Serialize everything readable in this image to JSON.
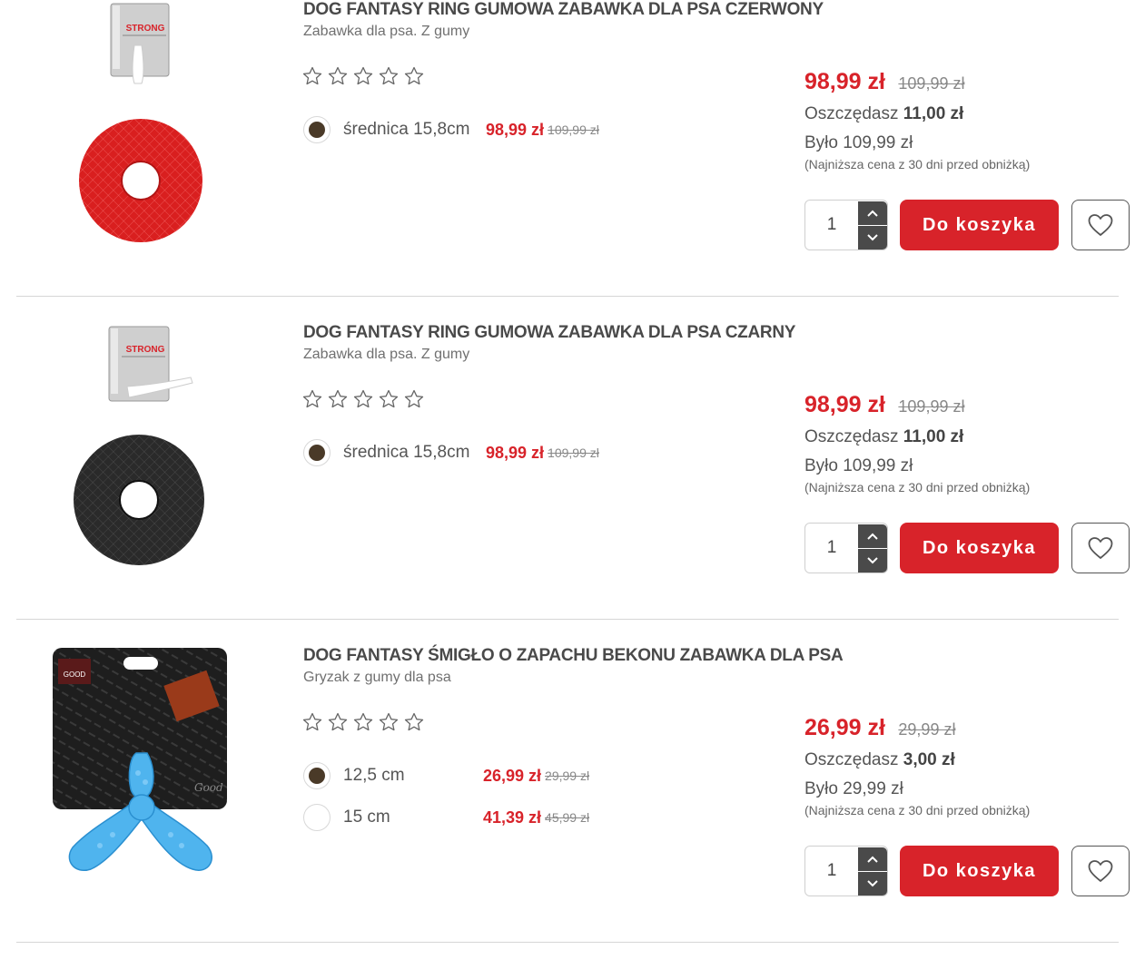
{
  "products": [
    {
      "title": "DOG FANTASY RING GUMOWA ZABAWKA DLA PSA CZERWONY",
      "subtitle": "Zabawka  dla psa. Z gumy",
      "rating_stars": 0,
      "image_icon": "red-rubber-ring-toy",
      "variants": [
        {
          "label": "średnica 15,8cm",
          "price": "98,99 zł",
          "old_price": "109,99 zł",
          "selected": true
        }
      ],
      "price": "98,99 zł",
      "old_price": "109,99 zł",
      "save_label": "Oszczędasz",
      "save_value": "11,00 zł",
      "was": "Było 109,99 zł",
      "lowest_note": "(Najniższa cena z 30 dni przed obniżką)",
      "quantity": "1",
      "cart_label": "Do koszyka"
    },
    {
      "title": "DOG FANTASY RING GUMOWA ZABAWKA DLA PSA CZARNY",
      "subtitle": "Zabawka  dla psa. Z gumy",
      "rating_stars": 0,
      "image_icon": "black-rubber-ring-toy",
      "variants": [
        {
          "label": "średnica 15,8cm",
          "price": "98,99 zł",
          "old_price": "109,99 zł",
          "selected": true
        }
      ],
      "price": "98,99 zł",
      "old_price": "109,99 zł",
      "save_label": "Oszczędasz",
      "save_value": "11,00 zł",
      "was": "Było 109,99 zł",
      "lowest_note": "(Najniższa cena z 30 dni przed obniżką)",
      "quantity": "1",
      "cart_label": "Do koszyka"
    },
    {
      "title": "DOG FANTASY ŚMIGŁO O ZAPACHU BEKONU ZABAWKA DLA PSA",
      "subtitle": "Gryzak z gumy dla psa",
      "rating_stars": 0,
      "image_icon": "blue-propeller-chew-toy",
      "variants": [
        {
          "label": "12,5 cm",
          "price": "26,99 zł",
          "old_price": "29,99 zł",
          "selected": true
        },
        {
          "label": "15 cm",
          "price": "41,39 zł",
          "old_price": "45,99 zł",
          "selected": false
        }
      ],
      "price": "26,99 zł",
      "old_price": "29,99 zł",
      "save_label": "Oszczędasz",
      "save_value": "3,00 zł",
      "was": "Było 29,99 zł",
      "lowest_note": "(Najniższa cena z 30 dni przed obniżką)",
      "quantity": "1",
      "cart_label": "Do koszyka"
    }
  ],
  "colors": {
    "accent_red": "#d8232a",
    "text_dark": "#444444",
    "text_muted": "#888888",
    "divider": "#d6d6d6",
    "qty_stepper": "#4a4a4a",
    "selected_swatch": "#4a3a28"
  }
}
